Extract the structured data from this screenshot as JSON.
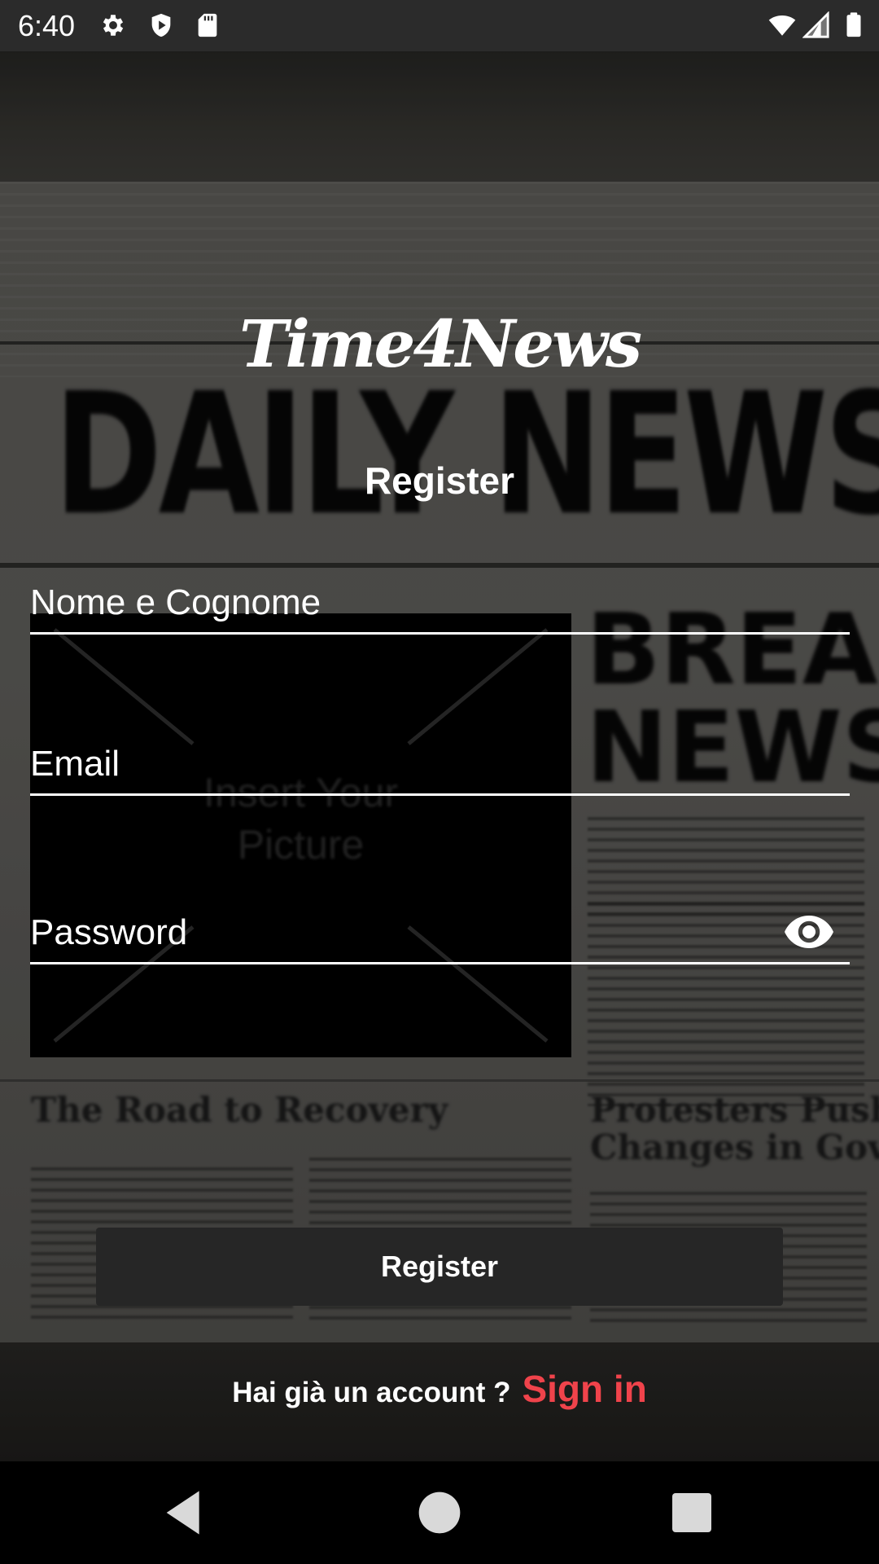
{
  "status_bar": {
    "time": "6:40",
    "left_icons": [
      "gear-icon",
      "shield-play-icon",
      "sd-card-icon"
    ],
    "right_icons": [
      "wifi-icon",
      "cell-signal-icon",
      "battery-icon"
    ]
  },
  "background": {
    "masthead": "DAILY NEWS",
    "breaking_line1": "BREA",
    "breaking_line2": "NEWS",
    "photo_placeholder_line1": "Insert Your",
    "photo_placeholder_line2": "Picture",
    "headline_left": "The Road to Recovery",
    "headline_right_line1": "Protesters Push",
    "headline_right_line2": "Changes in Gove"
  },
  "app": {
    "logo": "Time4News",
    "screen_title": "Register",
    "fields": {
      "name_placeholder": "Nome e Cognome",
      "email_placeholder": "Email",
      "password_placeholder": "Password"
    },
    "register_button_label": "Register",
    "signin_prompt": "Hai già un account ?",
    "signin_link": "Sign in"
  },
  "colors": {
    "accent": "#f0434b",
    "button_bg": "#262626",
    "status_bar_bg": "#2b2b2b"
  },
  "nav_bar": {
    "icons": [
      "back-icon",
      "home-icon",
      "recents-icon"
    ]
  }
}
